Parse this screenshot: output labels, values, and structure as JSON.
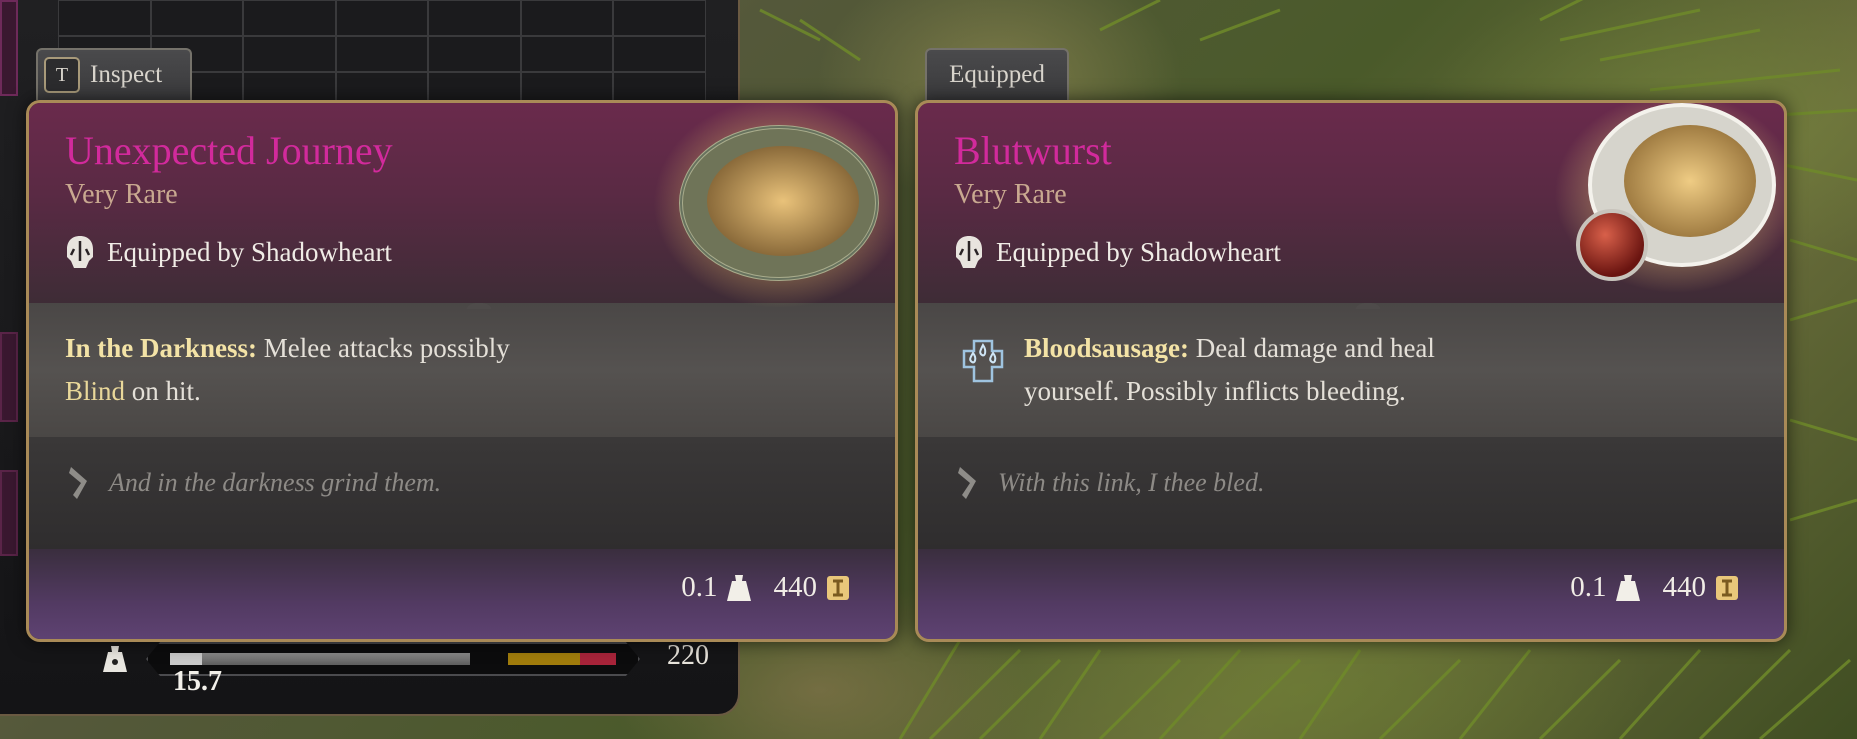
{
  "inventory": {
    "weight_current": "15.7",
    "weight_max": "220"
  },
  "tabs": {
    "inspect_key": "T",
    "inspect_label": "Inspect",
    "equipped_label": "Equipped"
  },
  "cards": [
    {
      "name": "Unexpected Journey",
      "rarity": "Very Rare",
      "equipped_by": "Equipped by Shadowheart",
      "passive_title": "In the Darkness:",
      "passive_text_1": " Melee attacks possibly",
      "passive_keyword": "Blind",
      "passive_text_2": " on hit.",
      "lore": "And in the darkness grind them.",
      "weight": "0.1",
      "value": "440"
    },
    {
      "name": "Blutwurst",
      "rarity": "Very Rare",
      "equipped_by": "Equipped by Shadowheart",
      "passive_title": "Bloodsausage:",
      "passive_text_1": " Deal damage and heal",
      "passive_text_2": "yourself. Possibly inflicts bleeding.",
      "lore": "With this link, I thee bled.",
      "weight": "0.1",
      "value": "440"
    }
  ],
  "colors": {
    "item_name": "#d22a9c",
    "rarity": "#c9a990",
    "keyword": "#f3e3a6",
    "card_border": "#a98a57"
  },
  "icons": [
    "helmet-icon",
    "blood-drops-icon",
    "quill-icon",
    "weight-icon",
    "gold-coin-icon",
    "ring-icon"
  ]
}
